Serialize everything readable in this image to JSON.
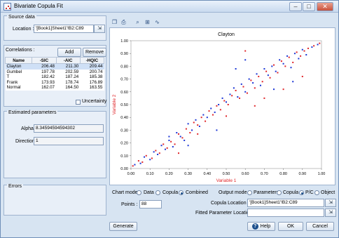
{
  "window": {
    "title": "Bivariate Copula Fit"
  },
  "source": {
    "group": "Source data",
    "location_label": "Location :",
    "location_value": "'[Book1]Sheet1'!B2:C89"
  },
  "correlations": {
    "label": "Correlations :",
    "add": "Add",
    "remove": "Remove",
    "headers": [
      "Name",
      "-SIC",
      "-AIC",
      "-HQIC"
    ],
    "rows": [
      [
        "Clayton",
        "206.48",
        "211.30",
        "209.44"
      ],
      [
        "Gumbel",
        "197.78",
        "202.59",
        "200.74"
      ],
      [
        "T",
        "182.42",
        "187.24",
        "185.38"
      ],
      [
        "Frank",
        "173.93",
        "178.74",
        "176.89"
      ],
      [
        "Normal",
        "162.07",
        "164.50",
        "163.55"
      ]
    ],
    "uncertainty": "Uncertainty"
  },
  "estimated": {
    "group": "Estimated parameters",
    "alpha_label": "Alpha",
    "alpha_value": "8.34594594594302",
    "direction_label": "Direction",
    "direction_value": "1"
  },
  "errors": {
    "group": "Errors"
  },
  "chart_mode": {
    "label": "Chart mode :",
    "options": [
      "Data",
      "Copula",
      "Combined"
    ],
    "selected": "Combined"
  },
  "points": {
    "label": "Points :",
    "value": "88"
  },
  "output_mode": {
    "label": "Output mode :",
    "options": [
      "Parameters",
      "Copula",
      "P/C",
      "Object"
    ],
    "selected": "P/C"
  },
  "copula_location": {
    "label": "Copula Location :",
    "value": "'[Book1]Sheet1'!B2:C89"
  },
  "fitted_location": {
    "label": "Fitted Parameter Location :",
    "value": ""
  },
  "buttons": {
    "generate": "Generate",
    "help": "Help",
    "ok": "OK",
    "cancel": "Cancel"
  },
  "icons": {
    "copy": "copy-icon",
    "print": "print-icon",
    "zoom": "zoom-icon",
    "export": "export-icon",
    "chart": "chart-icon"
  },
  "colors": {
    "data_points": "#1a35d6",
    "copula_points": "#e0262a",
    "axis_title": "#e0262a"
  },
  "chart_data": {
    "type": "scatter",
    "title": "Clayton",
    "xlabel": "Variable 1",
    "ylabel": "Variable 2",
    "xlim": [
      0,
      1
    ],
    "ylim": [
      0,
      1
    ],
    "xticks": [
      "0.00",
      "0.10",
      "0.20",
      "0.30",
      "0.40",
      "0.50",
      "0.60",
      "0.70",
      "0.80",
      "0.90",
      "1.00"
    ],
    "yticks": [
      "0.00",
      "0.10",
      "0.20",
      "0.30",
      "0.40",
      "0.50",
      "0.60",
      "0.70",
      "0.80",
      "0.90",
      "1.00"
    ],
    "series": [
      {
        "color": "#1a35d6",
        "x": [
          0.02,
          0.05,
          0.07,
          0.1,
          0.12,
          0.14,
          0.16,
          0.18,
          0.2,
          0.22,
          0.24,
          0.26,
          0.28,
          0.3,
          0.32,
          0.34,
          0.36,
          0.38,
          0.4,
          0.42,
          0.44,
          0.46,
          0.48,
          0.5,
          0.52,
          0.54,
          0.56,
          0.58,
          0.6,
          0.62,
          0.64,
          0.66,
          0.68,
          0.7,
          0.72,
          0.74,
          0.76,
          0.78,
          0.8,
          0.82,
          0.84,
          0.86,
          0.88,
          0.9,
          0.92,
          0.95,
          0.98,
          0.55,
          0.6,
          0.75,
          0.3,
          0.45,
          0.85,
          0.2
        ],
        "y": [
          0.03,
          0.04,
          0.09,
          0.07,
          0.13,
          0.11,
          0.18,
          0.15,
          0.22,
          0.17,
          0.28,
          0.25,
          0.22,
          0.35,
          0.3,
          0.38,
          0.33,
          0.42,
          0.4,
          0.47,
          0.44,
          0.5,
          0.55,
          0.52,
          0.58,
          0.63,
          0.56,
          0.66,
          0.6,
          0.7,
          0.67,
          0.74,
          0.65,
          0.78,
          0.73,
          0.8,
          0.76,
          0.85,
          0.82,
          0.88,
          0.79,
          0.9,
          0.86,
          0.93,
          0.89,
          0.95,
          0.97,
          0.78,
          0.85,
          0.62,
          0.18,
          0.3,
          0.68,
          0.25
        ]
      },
      {
        "color": "#e0262a",
        "x": [
          0.01,
          0.04,
          0.06,
          0.08,
          0.11,
          0.13,
          0.15,
          0.17,
          0.19,
          0.21,
          0.23,
          0.25,
          0.27,
          0.29,
          0.31,
          0.33,
          0.35,
          0.37,
          0.39,
          0.41,
          0.43,
          0.45,
          0.47,
          0.49,
          0.51,
          0.53,
          0.55,
          0.57,
          0.59,
          0.61,
          0.63,
          0.65,
          0.67,
          0.69,
          0.71,
          0.73,
          0.75,
          0.77,
          0.79,
          0.81,
          0.83,
          0.85,
          0.87,
          0.89,
          0.91,
          0.93,
          0.96,
          0.99,
          0.5,
          0.65,
          0.35,
          0.8,
          0.6,
          0.25,
          0.7,
          0.9
        ],
        "y": [
          0.02,
          0.06,
          0.05,
          0.1,
          0.08,
          0.14,
          0.12,
          0.19,
          0.16,
          0.21,
          0.19,
          0.27,
          0.24,
          0.31,
          0.28,
          0.36,
          0.34,
          0.4,
          0.37,
          0.45,
          0.42,
          0.49,
          0.46,
          0.53,
          0.5,
          0.57,
          0.61,
          0.55,
          0.64,
          0.59,
          0.69,
          0.63,
          0.72,
          0.68,
          0.76,
          0.71,
          0.81,
          0.75,
          0.84,
          0.8,
          0.87,
          0.83,
          0.91,
          0.88,
          0.92,
          0.94,
          0.96,
          0.98,
          0.41,
          0.49,
          0.27,
          0.62,
          0.92,
          0.12,
          0.55,
          0.72
        ]
      }
    ]
  }
}
